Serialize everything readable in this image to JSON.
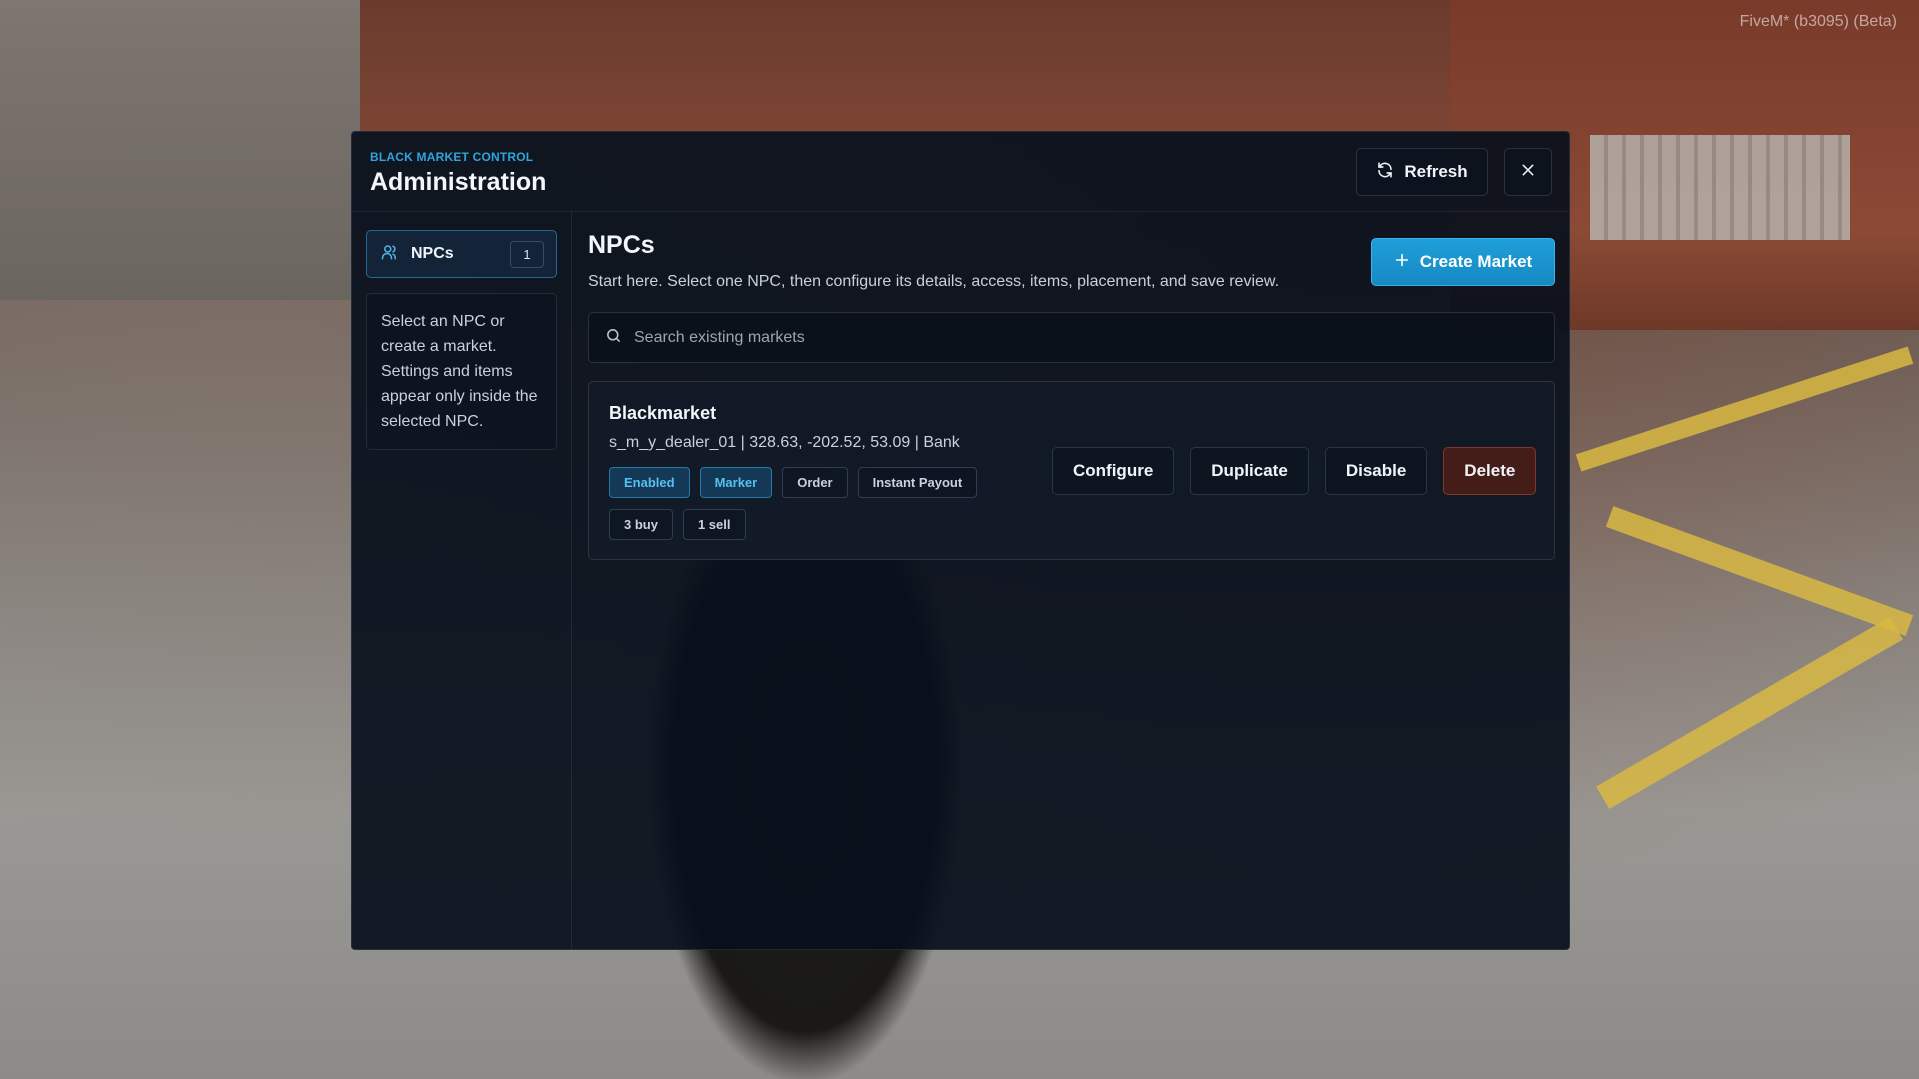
{
  "overlay": {
    "build_label": "FiveM* (b3095) (Beta)"
  },
  "header": {
    "eyebrow": "BLACK MARKET CONTROL",
    "title": "Administration",
    "refresh_label": "Refresh",
    "close_icon": "close-icon"
  },
  "sidebar": {
    "items": [
      {
        "label": "NPCs",
        "count": "1",
        "icon": "users-icon"
      }
    ],
    "help_text": "Select an NPC or create a market. Settings and items appear only inside the selected NPC."
  },
  "main": {
    "title": "NPCs",
    "subtitle": "Start here. Select one NPC, then configure its details, access, items, placement, and save review.",
    "create_label": "Create Market",
    "search": {
      "placeholder": "Search existing markets",
      "value": ""
    },
    "markets": [
      {
        "name": "Blackmarket",
        "meta": "s_m_y_dealer_01 | 328.63, -202.52, 53.09 | Bank",
        "tags": [
          "Enabled",
          "Marker",
          "Order",
          "Instant Payout"
        ],
        "counts": [
          "3 buy",
          "1 sell"
        ],
        "actions": {
          "configure": "Configure",
          "duplicate": "Duplicate",
          "disable": "Disable",
          "delete": "Delete"
        }
      }
    ]
  },
  "colors": {
    "accent": "#2fa4dd",
    "panel": "#09101c",
    "danger": "#4e1e16"
  }
}
